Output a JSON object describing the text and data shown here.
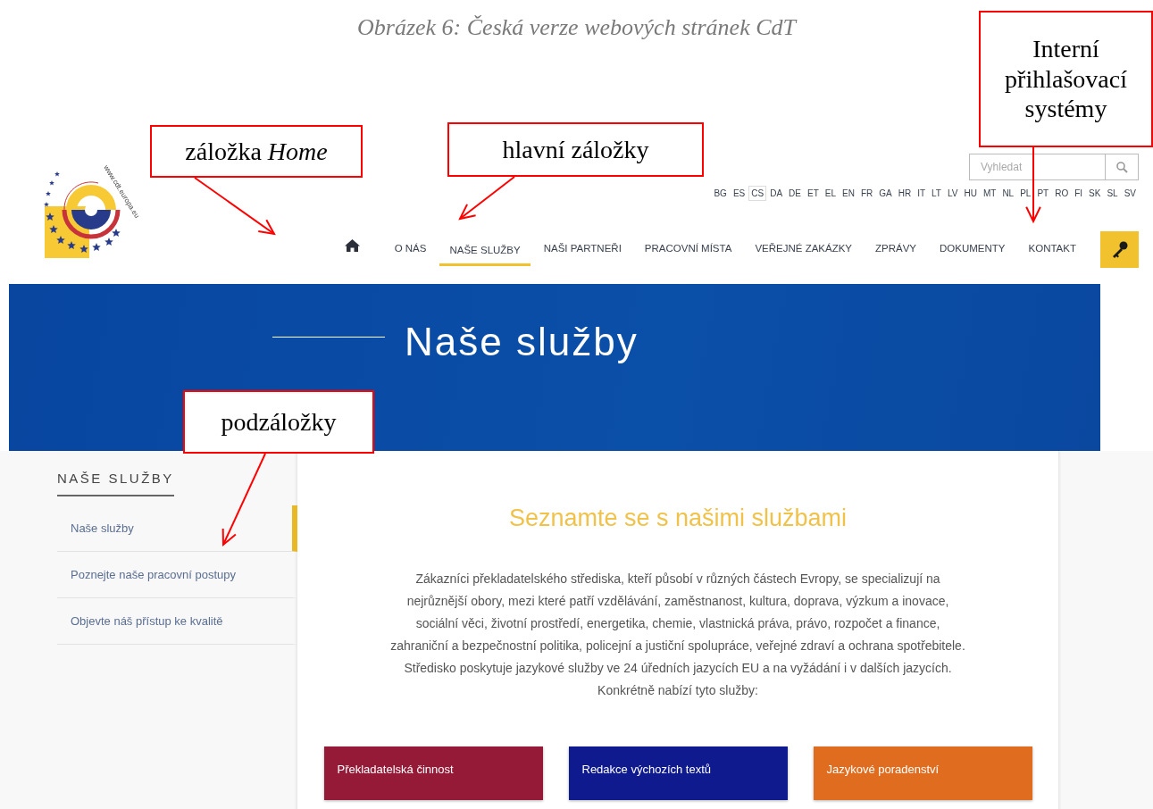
{
  "caption": "Obrázek 6: Česká verze webových stránek CdT",
  "annotations": [
    {
      "text": "záložka *Home*"
    },
    {
      "text": "hlavní záložky"
    },
    {
      "text": "Interní přihlašovací systémy"
    },
    {
      "text": "podzáložky"
    }
  ],
  "header": {
    "logo_text": "www.cdt.europa.eu",
    "search": {
      "placeholder": "Vyhledat"
    },
    "languages": [
      {
        "code": "BG",
        "selected": false
      },
      {
        "code": "ES",
        "selected": false
      },
      {
        "code": "CS",
        "selected": true
      },
      {
        "code": "DA",
        "selected": false
      },
      {
        "code": "DE",
        "selected": false
      },
      {
        "code": "ET",
        "selected": false
      },
      {
        "code": "EL",
        "selected": false
      },
      {
        "code": "EN",
        "selected": false
      },
      {
        "code": "FR",
        "selected": false
      },
      {
        "code": "GA",
        "selected": false
      },
      {
        "code": "HR",
        "selected": false
      },
      {
        "code": "IT",
        "selected": false
      },
      {
        "code": "LT",
        "selected": false
      },
      {
        "code": "LV",
        "selected": false
      },
      {
        "code": "HU",
        "selected": false
      },
      {
        "code": "MT",
        "selected": false
      },
      {
        "code": "NL",
        "selected": false
      },
      {
        "code": "PL",
        "selected": false
      },
      {
        "code": "PT",
        "selected": false
      },
      {
        "code": "RO",
        "selected": false
      },
      {
        "code": "FI",
        "selected": false
      },
      {
        "code": "SK",
        "selected": false
      },
      {
        "code": "SL",
        "selected": false
      },
      {
        "code": "SV",
        "selected": false
      }
    ],
    "nav": [
      {
        "label": "O NÁS",
        "selected": false
      },
      {
        "label": "NAŠE SLUŽBY",
        "selected": true
      },
      {
        "label": "NAŠI PARTNEŘI",
        "selected": false
      },
      {
        "label": "PRACOVNÍ MÍSTA",
        "selected": false
      },
      {
        "label": "VEŘEJNÉ ZAKÁZKY",
        "selected": false
      },
      {
        "label": "ZPRÁVY",
        "selected": false
      },
      {
        "label": "DOKUMENTY",
        "selected": false
      },
      {
        "label": "KONTAKT",
        "selected": false
      }
    ]
  },
  "banner": {
    "title": "Naše služby"
  },
  "sidebar": {
    "title": "NAŠE SLUŽBY",
    "items": [
      {
        "label": "Naše služby",
        "selected": true
      },
      {
        "label": "Poznejte naše pracovní postupy",
        "selected": false
      },
      {
        "label": "Objevte náš přístup ke kvalitě",
        "selected": false
      }
    ]
  },
  "content": {
    "heading": "Seznamte se s našimi službami",
    "text": "Zákazníci překladatelského střediska, kteří působí v různých částech Evropy, se specializují na nejrůznější obory, mezi které patří vzdělávání, zaměstnanost, kultura, doprava, výzkum a inovace, sociální věci, životní prostředí, energetika, chemie, vlastnická práva, právo, rozpočet a finance, zahraniční a bezpečnostní politika, policejní a justiční spolupráce, veřejné zdraví a ochrana spotřebitele. Středisko poskytuje jazykové služby ve 24 úředních jazycích EU a na vyžádání i v dalších jazycích. Konkrétně nabízí tyto služby:",
    "services": [
      {
        "label": "Překladatelská činnost",
        "color": "#951a37"
      },
      {
        "label": "Redakce výchozích textů",
        "color": "#0e1a8e"
      },
      {
        "label": "Jazykové poradenství",
        "color": "#e06d1f"
      }
    ]
  }
}
